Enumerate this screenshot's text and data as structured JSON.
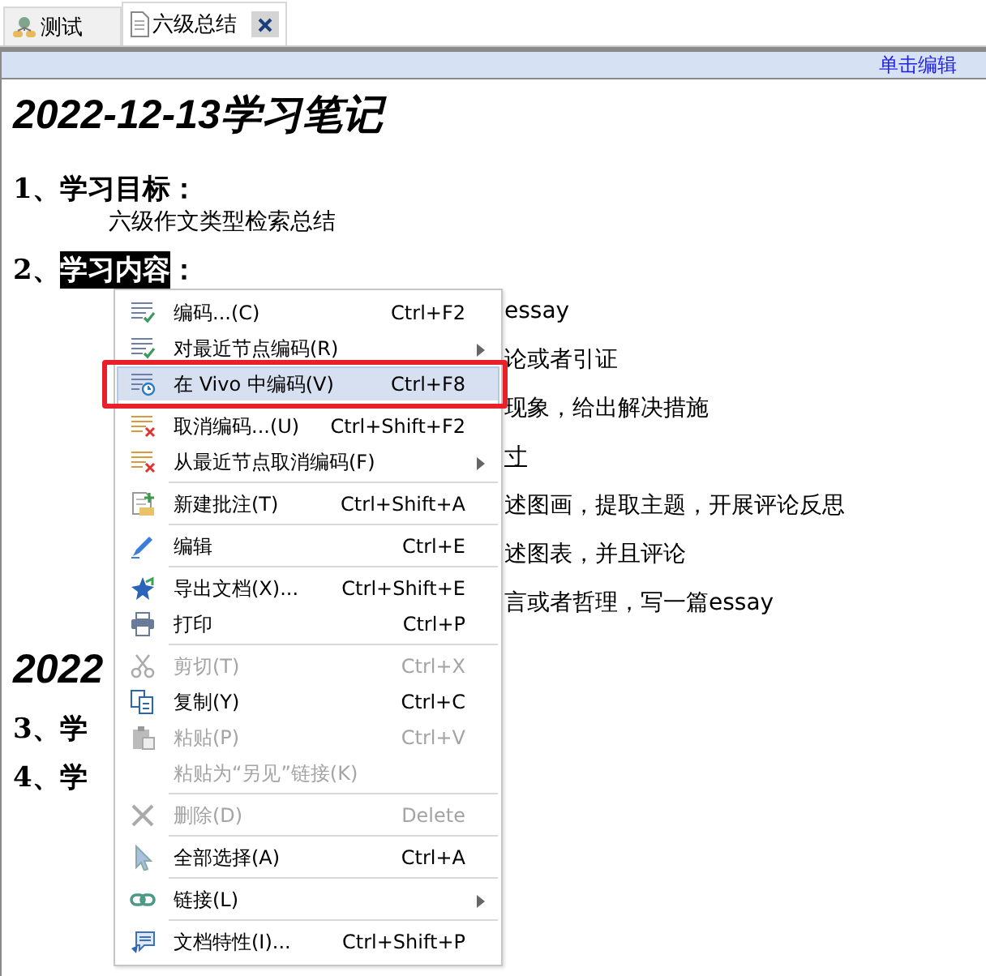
{
  "tabs": [
    {
      "label": "测试",
      "selected": false,
      "closable": false
    },
    {
      "label": "六级总结",
      "selected": true,
      "closable": true
    }
  ],
  "edit_bar": {
    "link": "单击编辑"
  },
  "document": {
    "lines": [
      {
        "kind": "title",
        "text": "2022-12-13学习笔记"
      },
      {
        "kind": "heading",
        "parts": [
          {
            "text": "1、学习目标：",
            "selected": false
          }
        ]
      },
      {
        "kind": "body",
        "text": "六级作文类型检索总结"
      },
      {
        "kind": "heading",
        "parts": [
          {
            "text": "2、",
            "selected": false
          },
          {
            "text": "学习内容",
            "selected": true
          },
          {
            "text": "：",
            "selected": false
          }
        ]
      },
      {
        "kind": "fragment",
        "text": "essay",
        "underlined": false
      },
      {
        "kind": "fragment",
        "text": "论或者引证",
        "underlined": false
      },
      {
        "kind": "fragment",
        "text": "现象，给出解决措施",
        "underlined": false
      },
      {
        "kind": "fragment",
        "text": "寸",
        "underlined": true
      },
      {
        "kind": "fragment",
        "text": "述图画，提取主题，开展评论反思",
        "underlined": false
      },
      {
        "kind": "fragment",
        "text": "述图表，并且评论",
        "underlined": false
      },
      {
        "kind": "fragment",
        "text": "言或者哲理，写一篇essay",
        "underlined": false
      },
      {
        "kind": "title",
        "text": "2022"
      },
      {
        "kind": "heading",
        "parts": [
          {
            "text": "3、学",
            "selected": false
          }
        ]
      },
      {
        "kind": "heading",
        "parts": [
          {
            "text": "4、学",
            "selected": false
          }
        ]
      }
    ]
  },
  "context_menu": {
    "items": [
      {
        "label": "编码...(C)",
        "shortcut": "Ctrl+F2",
        "disabled": false,
        "submenu": false,
        "selected": false,
        "separator_after": false
      },
      {
        "label": "对最近节点编码(R)",
        "disabled": false,
        "submenu": true,
        "selected": false,
        "separator_after": false
      },
      {
        "label": "在 Vivo  中编码(V)",
        "shortcut": "Ctrl+F8",
        "disabled": false,
        "submenu": false,
        "selected": true,
        "outlined": true,
        "separator_after": true
      },
      {
        "label": "取消编码...(U)",
        "shortcut": "Ctrl+Shift+F2",
        "disabled": false,
        "submenu": false,
        "selected": false,
        "separator_after": false
      },
      {
        "label": "从最近节点取消编码(F)",
        "disabled": false,
        "submenu": true,
        "selected": false,
        "separator_after": true
      },
      {
        "label": "新建批注(T)",
        "shortcut": "Ctrl+Shift+A",
        "disabled": false,
        "submenu": false,
        "selected": false,
        "separator_after": true
      },
      {
        "label": "编辑",
        "shortcut": "Ctrl+E",
        "disabled": false,
        "submenu": false,
        "selected": false,
        "separator_after": true
      },
      {
        "label": "导出文档(X)...",
        "shortcut": "Ctrl+Shift+E",
        "disabled": false,
        "submenu": false,
        "selected": false,
        "separator_after": false
      },
      {
        "label": "打印",
        "shortcut": "Ctrl+P",
        "disabled": false,
        "submenu": false,
        "selected": false,
        "separator_after": true
      },
      {
        "label": "剪切(T)",
        "shortcut": "Ctrl+X",
        "disabled": true,
        "submenu": false,
        "selected": false,
        "separator_after": false
      },
      {
        "label": "复制(Y)",
        "shortcut": "Ctrl+C",
        "disabled": false,
        "submenu": false,
        "selected": false,
        "separator_after": false
      },
      {
        "label": "粘贴(P)",
        "shortcut": "Ctrl+V",
        "disabled": true,
        "submenu": false,
        "selected": false,
        "separator_after": false
      },
      {
        "label": "粘贴为“另见”链接(K)",
        "disabled": true,
        "submenu": false,
        "selected": false,
        "separator_after": true
      },
      {
        "label": "删除(D)",
        "shortcut": "Delete",
        "disabled": true,
        "submenu": false,
        "selected": false,
        "separator_after": true
      },
      {
        "label": "全部选择(A)",
        "shortcut": "Ctrl+A",
        "disabled": false,
        "submenu": false,
        "selected": false,
        "separator_after": true
      },
      {
        "label": "链接(L)",
        "disabled": false,
        "submenu": true,
        "selected": false,
        "separator_after": true
      },
      {
        "label": "文档特性(I)...",
        "shortcut": "Ctrl+Shift+P",
        "disabled": false,
        "submenu": false,
        "selected": false,
        "separator_after": false
      }
    ]
  }
}
